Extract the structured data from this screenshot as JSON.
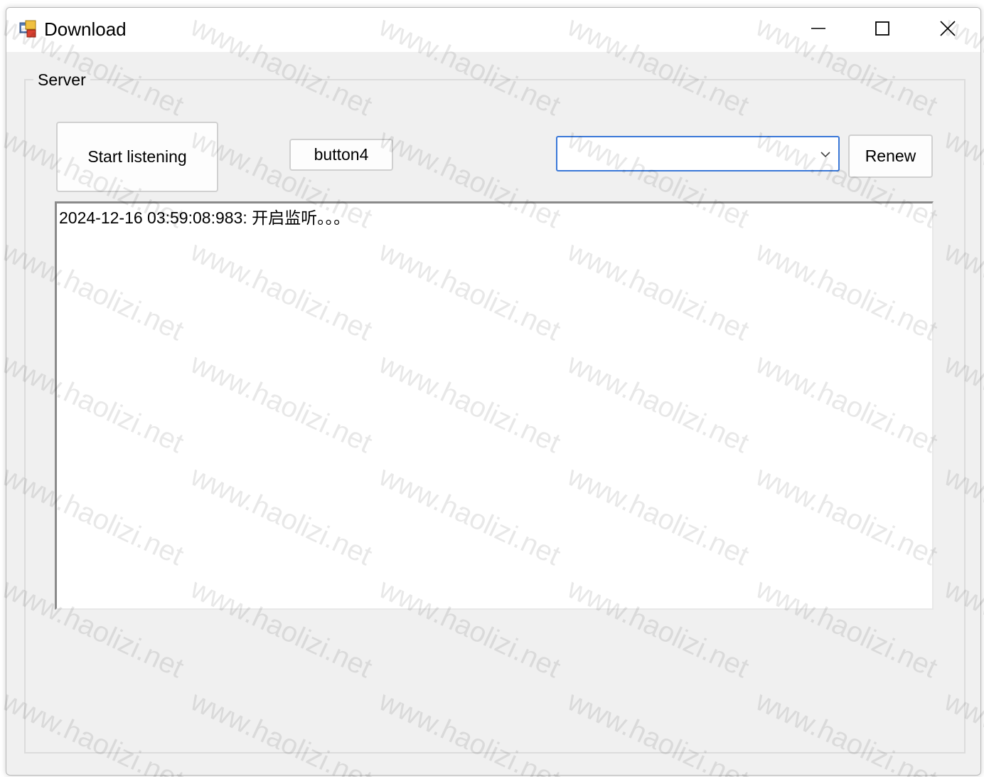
{
  "window": {
    "title": "Download",
    "controls": {
      "minimize": "minimize",
      "maximize": "maximize",
      "close": "close"
    }
  },
  "group": {
    "label": "Server"
  },
  "toolbar": {
    "start_label": "Start listening",
    "button4_label": "button4",
    "combo_value": "",
    "renew_label": "Renew"
  },
  "log": {
    "lines": [
      "2024-12-16 03:59:08:983:  开启监听。。。"
    ]
  },
  "watermark": {
    "text": "www.haolizi.net"
  },
  "colors": {
    "window_bg": "#f0f0f0",
    "focus_border": "#3a78d8"
  },
  "icons": {
    "app": "app-window-icon",
    "minimize": "minimize-icon",
    "maximize": "maximize-icon",
    "close": "close-icon",
    "dropdown": "chevron-down-icon"
  }
}
